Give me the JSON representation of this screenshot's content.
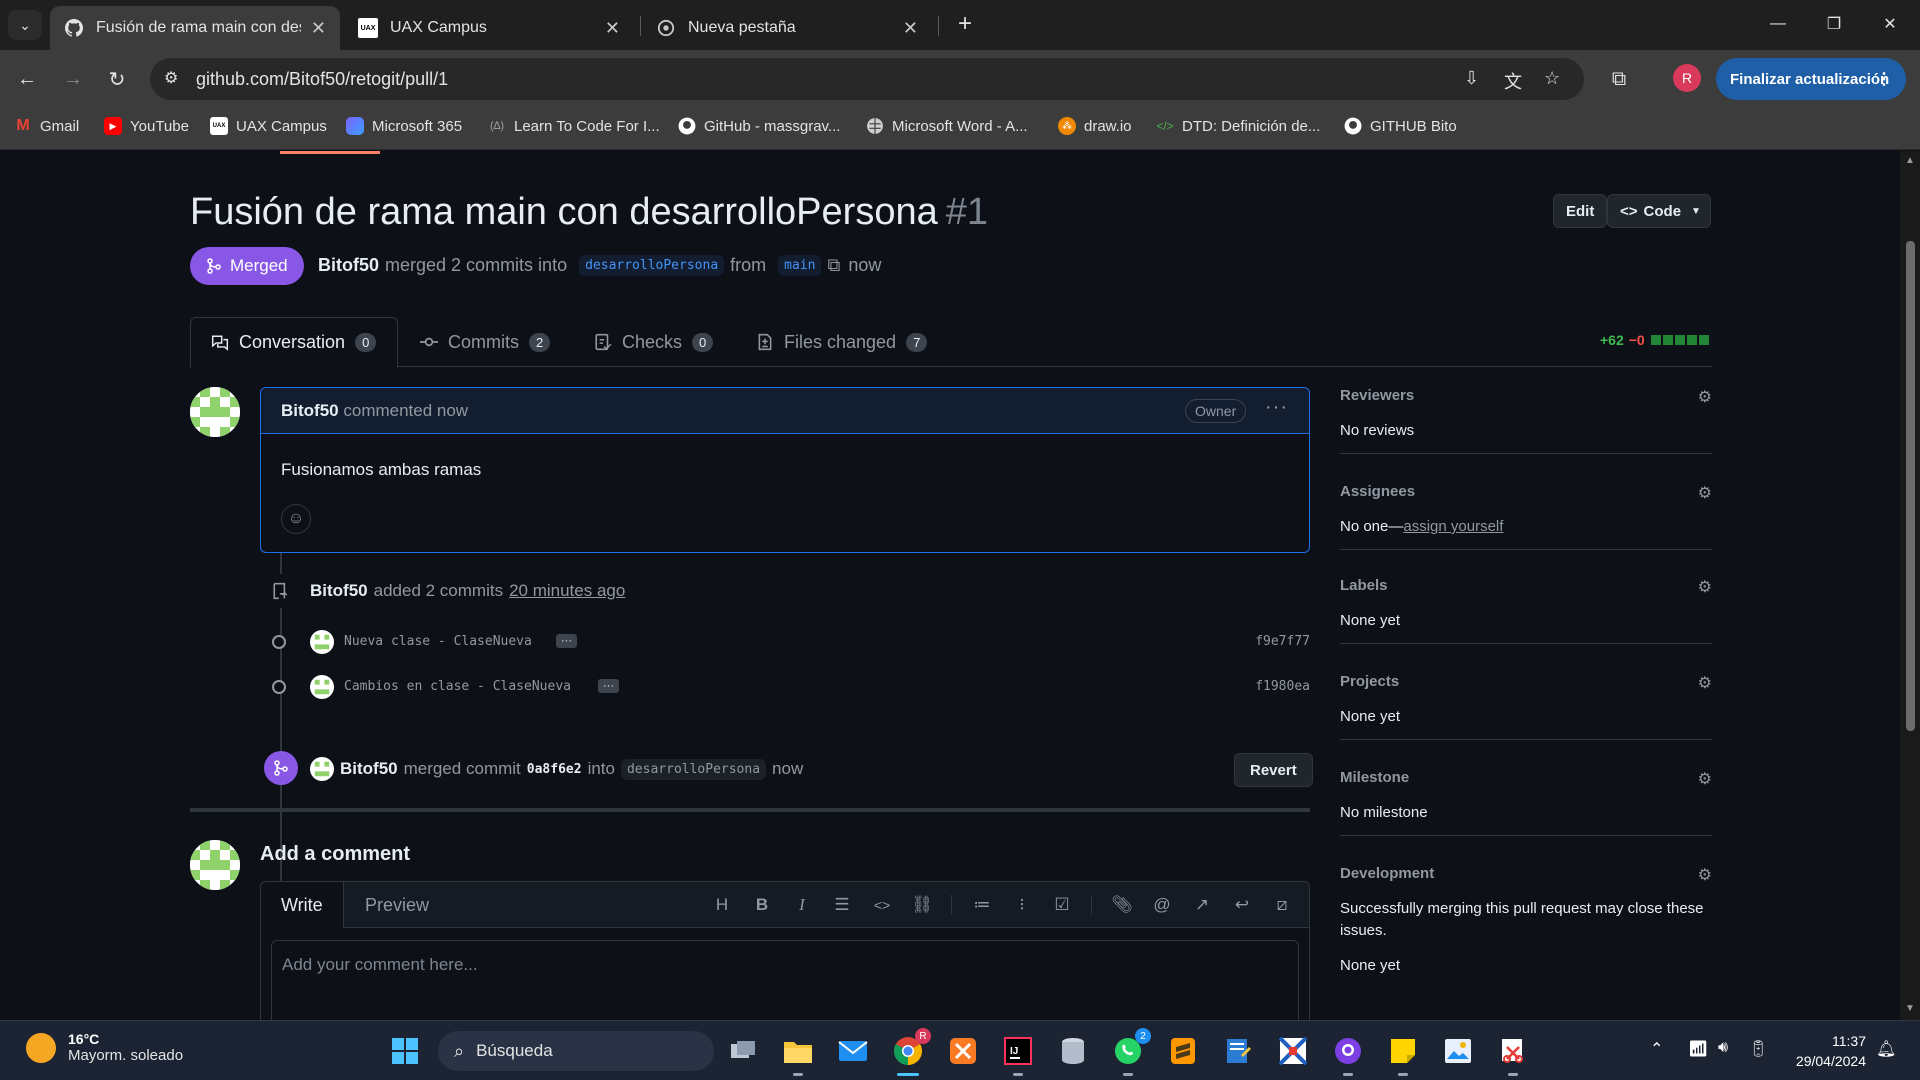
{
  "browser": {
    "tabs": [
      {
        "title": "Fusión de rama main con desarrollo…",
        "favicon": "github-icon",
        "active": true
      },
      {
        "title": "UAX Campus",
        "favicon": "uax-icon",
        "active": false
      },
      {
        "title": "Nueva pestaña",
        "favicon": "chrome-icon",
        "active": false
      }
    ],
    "url": "github.com/Bitof50/retogit/pull/1",
    "profile_initial": "R",
    "update_label": "Finalizar actualización",
    "bookmarks": [
      {
        "label": "Gmail",
        "icon": "gmail-icon",
        "color": "#ea4335"
      },
      {
        "label": "YouTube",
        "icon": "youtube-icon",
        "color": "#ff0000"
      },
      {
        "label": "UAX Campus",
        "icon": "uax-icon",
        "color": "#ffffff"
      },
      {
        "label": "Microsoft 365",
        "icon": "microsoft365-icon",
        "color": "#7b61ff"
      },
      {
        "label": "Learn To Code For I...",
        "icon": "freecodecamp-icon",
        "color": "#a0a0a0"
      },
      {
        "label": "GitHub - massgrav...",
        "icon": "github-icon",
        "color": "#ffffff"
      },
      {
        "label": "Microsoft Word - A...",
        "icon": "globe-icon",
        "color": "#cfcfcf"
      },
      {
        "label": "draw.io",
        "icon": "drawio-icon",
        "color": "#f08705"
      },
      {
        "label": "DTD: Definición de...",
        "icon": "code-icon",
        "color": "#4caf50"
      },
      {
        "label": "GITHUB Bito",
        "icon": "github-icon",
        "color": "#ffffff"
      }
    ]
  },
  "pr": {
    "title": "Fusión de rama main con desarrolloPersona",
    "number": "#1",
    "edit_label": "Edit",
    "code_label": "Code",
    "state": "Merged",
    "author": "Bitof50",
    "merged_text": "merged 2 commits into",
    "base_branch": "desarrolloPersona",
    "from_text": "from",
    "head_branch": "main",
    "time": "now",
    "tabs": [
      {
        "label": "Conversation",
        "count": "0",
        "icon": "comment-discussion-icon"
      },
      {
        "label": "Commits",
        "count": "2",
        "icon": "git-commit-icon"
      },
      {
        "label": "Checks",
        "count": "0",
        "icon": "checklist-icon"
      },
      {
        "label": "Files changed",
        "count": "7",
        "icon": "file-diff-icon"
      }
    ],
    "additions": "+62",
    "deletions": "−0"
  },
  "comment": {
    "author": "Bitof50",
    "action": "commented now",
    "role": "Owner",
    "body": "Fusionamos ambas ramas"
  },
  "timeline": {
    "push_author": "Bitof50",
    "push_text": "added 2 commits",
    "push_time": "20 minutes ago",
    "commits": [
      {
        "message": "Nueva clase - ClaseNueva",
        "sha": "f9e7f77"
      },
      {
        "message": "Cambios en clase - ClaseNueva",
        "sha": "f1980ea"
      }
    ],
    "merge_author": "Bitof50",
    "merge_text": "merged commit",
    "merge_sha": "0a8f6e2",
    "merge_into": "into",
    "merge_branch": "desarrolloPersona",
    "merge_time": "now",
    "revert_label": "Revert"
  },
  "new_comment": {
    "title": "Add a comment",
    "write_tab": "Write",
    "preview_tab": "Preview",
    "placeholder": "Add your comment here..."
  },
  "sidebar": {
    "reviewers": {
      "heading": "Reviewers",
      "value": "No reviews"
    },
    "assignees": {
      "heading": "Assignees",
      "value": "No one—",
      "link": "assign yourself"
    },
    "labels": {
      "heading": "Labels",
      "value": "None yet"
    },
    "projects": {
      "heading": "Projects",
      "value": "None yet"
    },
    "milestone": {
      "heading": "Milestone",
      "value": "No milestone"
    },
    "development": {
      "heading": "Development",
      "description": "Successfully merging this pull request may close these issues.",
      "value": "None yet"
    }
  },
  "taskbar": {
    "temperature": "16°C",
    "weather": "Mayorm. soleado",
    "search_placeholder": "Búsqueda",
    "time": "11:37",
    "date": "29/04/2024",
    "whatsapp_badge": "2",
    "chrome_badge": "R"
  },
  "colors": {
    "merged": "#8957e5",
    "link_blue": "#4493f8",
    "additions": "#3fb950",
    "deletions": "#f85149"
  }
}
